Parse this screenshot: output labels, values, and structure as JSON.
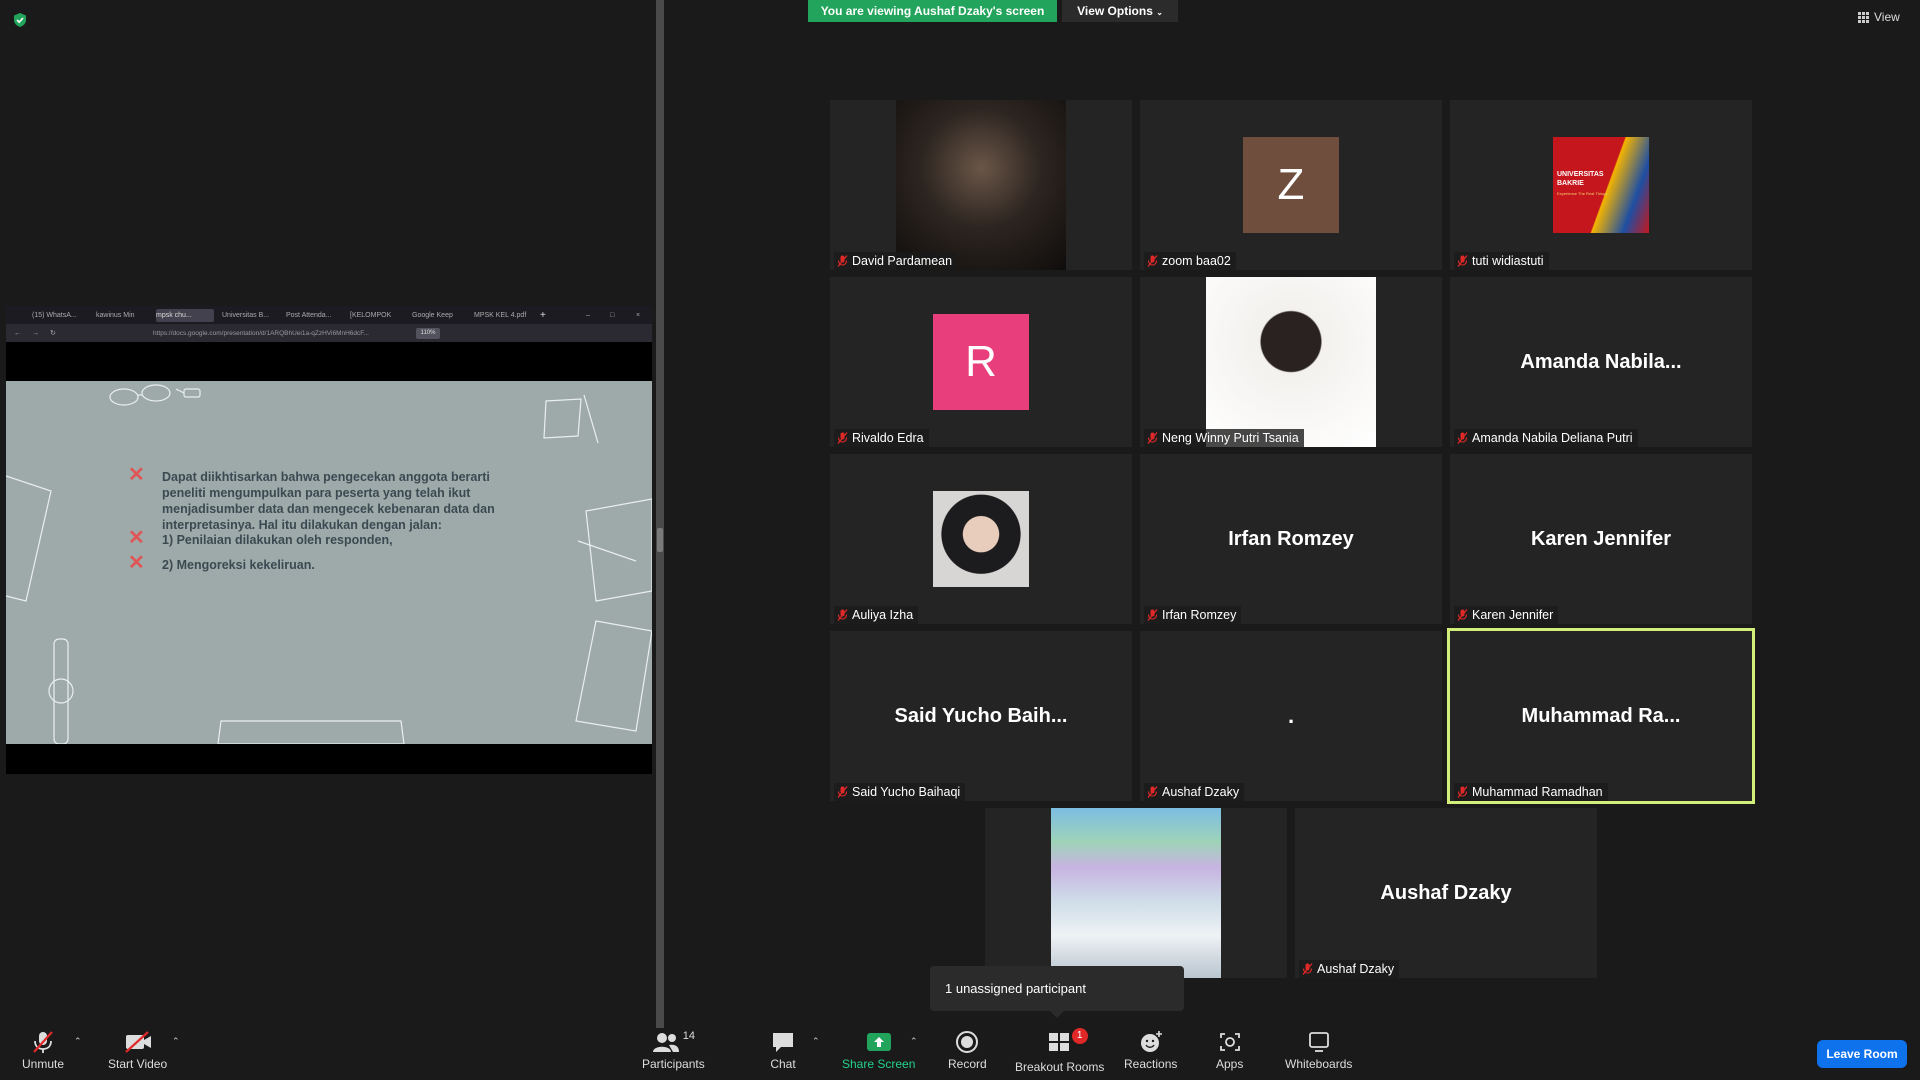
{
  "top": {
    "viewing_banner": "You are viewing Aushaf Dzaky's screen",
    "view_options": "View Options",
    "view_label": "View"
  },
  "shared_browser": {
    "tabs": [
      "(15) WhatsA...",
      "kawinus Min",
      "mpsk chu...",
      "Universitas B...",
      "Post Attenda...",
      "[KELOMPOK",
      "Google Keep",
      "MPSK KEL 4.pdf"
    ],
    "url": "https://docs.google.com/presentation/d/1ARQBhUei1a-qZzHVi6MnH6dcF...",
    "zoom": "110%"
  },
  "slide": {
    "paragraph": "Dapat diikhtisarkan bahwa pengecekan anggota berarti peneliti mengumpulkan para peserta yang telah ikut menjadisumber data dan mengecek kebenaran data dan interpretasinya. Hal itu dilakukan dengan jalan:",
    "point1": "1) Penilaian dilakukan oleh responden,",
    "point2": "2) Mengoreksi kekeliruan."
  },
  "participants": [
    {
      "name": "David Pardamean",
      "type": "photo"
    },
    {
      "name": "zoom baa02",
      "type": "letter",
      "letter": "Z",
      "color": "#6f4e3e"
    },
    {
      "name": "tuti widiastuti",
      "type": "logo",
      "logo_line1": "UNIVERSITAS",
      "logo_line2": "BAKRIE",
      "logo_tagline": "Experience The Real Things"
    },
    {
      "name": "Rivaldo Edra",
      "type": "letter",
      "letter": "R",
      "color": "#e83e7b"
    },
    {
      "name": "Neng Winny Putri Tsania",
      "type": "photo"
    },
    {
      "name": "Amanda Nabila Deliana Putri",
      "type": "text",
      "display": "Amanda  Nabila..."
    },
    {
      "name": "Auliya Izha",
      "type": "photo"
    },
    {
      "name": "Irfan Romzey",
      "type": "text",
      "display": "Irfan Romzey"
    },
    {
      "name": "Karen Jennifer",
      "type": "text",
      "display": "Karen Jennifer"
    },
    {
      "name": "Said Yucho Baihaqi",
      "type": "text",
      "display": "Said  Yucho  Baih..."
    },
    {
      "name": "Aushaf Dzaky",
      "type": "text",
      "display": "."
    },
    {
      "name": "Muhammad Ramadhan",
      "type": "text",
      "display": "Muhammad  Ra..."
    },
    {
      "name": "",
      "type": "photo"
    },
    {
      "name": "Aushaf Dzaky",
      "type": "text",
      "display": "Aushaf Dzaky"
    }
  ],
  "tooltip": "1 unassigned participant",
  "toolbar": {
    "unmute": "Unmute",
    "start_video": "Start Video",
    "participants": "Participants",
    "participants_count": "14",
    "chat": "Chat",
    "share_screen": "Share Screen",
    "record": "Record",
    "breakout_rooms": "Breakout Rooms",
    "breakout_badge": "1",
    "reactions": "Reactions",
    "apps": "Apps",
    "whiteboards": "Whiteboards",
    "leave_room": "Leave Room"
  },
  "colors": {
    "share_banner": "#23a45c",
    "active_speaker": "#d2ef7a",
    "leave": "#0e72ed",
    "muted": "#e02828"
  }
}
